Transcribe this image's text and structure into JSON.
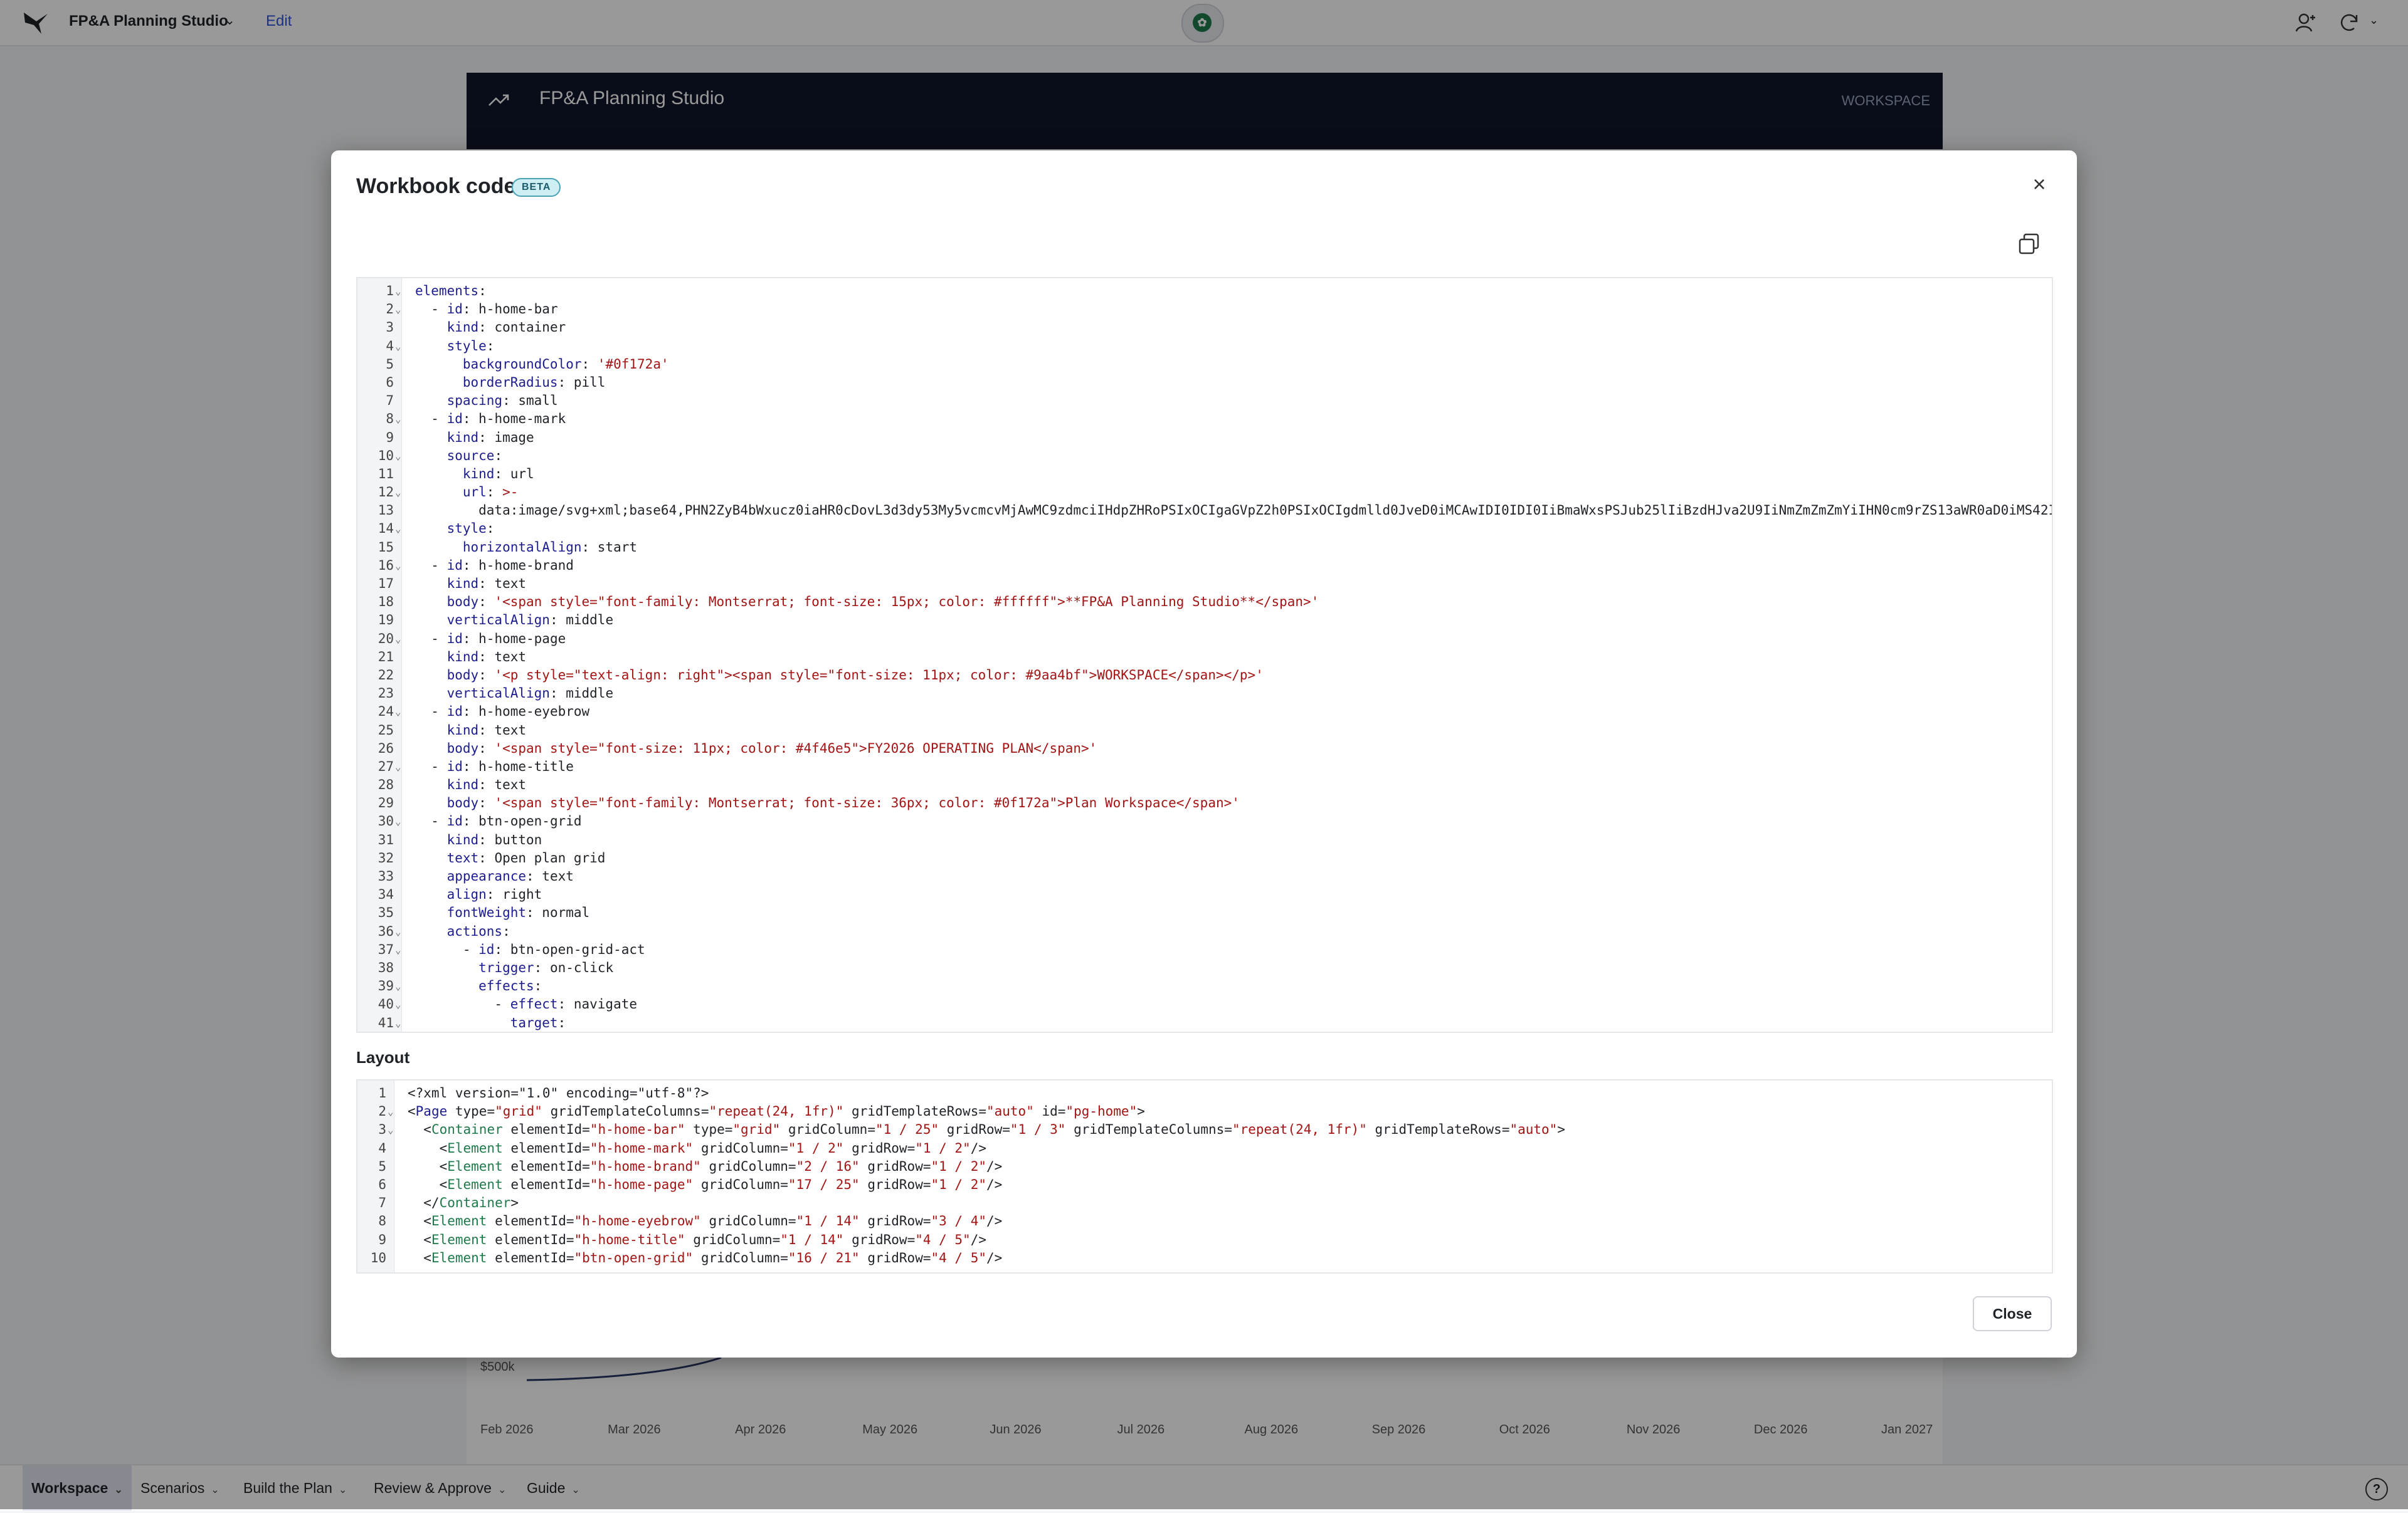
{
  "topbar": {
    "app_title": "FP&A Planning Studio",
    "edit_label": "Edit"
  },
  "background": {
    "header_brand": "FP&A Planning Studio",
    "header_right": "WORKSPACE",
    "chart": {
      "y_tick": "$500k",
      "x_ticks": [
        "Feb 2026",
        "Mar 2026",
        "Apr 2026",
        "May 2026",
        "Jun 2026",
        "Jul 2026",
        "Aug 2026",
        "Sep 2026",
        "Oct 2026",
        "Nov 2026",
        "Dec 2026",
        "Jan 2027"
      ]
    }
  },
  "bottom_tabs": [
    {
      "label": "Workspace",
      "active": true
    },
    {
      "label": "Scenarios",
      "active": false
    },
    {
      "label": "Build the Plan",
      "active": false
    },
    {
      "label": "Review & Approve",
      "active": false
    },
    {
      "label": "Guide",
      "active": false
    }
  ],
  "modal": {
    "title": "Workbook code",
    "badge": "BETA",
    "layout_heading": "Layout",
    "close_label": "Close",
    "code_lines": [
      {
        "n": "1",
        "fold": true,
        "segs": [
          [
            "k",
            "elements"
          ],
          [
            "p",
            ":"
          ]
        ]
      },
      {
        "n": "2",
        "fold": true,
        "segs": [
          [
            "p",
            "  - "
          ],
          [
            "k",
            "id"
          ],
          [
            "p",
            ": h-home-bar"
          ]
        ]
      },
      {
        "n": "3",
        "fold": false,
        "segs": [
          [
            "p",
            "    "
          ],
          [
            "k",
            "kind"
          ],
          [
            "p",
            ": container"
          ]
        ]
      },
      {
        "n": "4",
        "fold": true,
        "segs": [
          [
            "p",
            "    "
          ],
          [
            "k",
            "style"
          ],
          [
            "p",
            ":"
          ]
        ]
      },
      {
        "n": "5",
        "fold": false,
        "segs": [
          [
            "p",
            "      "
          ],
          [
            "k",
            "backgroundColor"
          ],
          [
            "p",
            ": "
          ],
          [
            "s",
            "'#0f172a'"
          ]
        ]
      },
      {
        "n": "6",
        "fold": false,
        "segs": [
          [
            "p",
            "      "
          ],
          [
            "k",
            "borderRadius"
          ],
          [
            "p",
            ": pill"
          ]
        ]
      },
      {
        "n": "7",
        "fold": false,
        "segs": [
          [
            "p",
            "    "
          ],
          [
            "k",
            "spacing"
          ],
          [
            "p",
            ": small"
          ]
        ]
      },
      {
        "n": "8",
        "fold": true,
        "segs": [
          [
            "p",
            "  - "
          ],
          [
            "k",
            "id"
          ],
          [
            "p",
            ": h-home-mark"
          ]
        ]
      },
      {
        "n": "9",
        "fold": false,
        "segs": [
          [
            "p",
            "    "
          ],
          [
            "k",
            "kind"
          ],
          [
            "p",
            ": image"
          ]
        ]
      },
      {
        "n": "10",
        "fold": true,
        "segs": [
          [
            "p",
            "    "
          ],
          [
            "k",
            "source"
          ],
          [
            "p",
            ":"
          ]
        ]
      },
      {
        "n": "11",
        "fold": false,
        "segs": [
          [
            "p",
            "      "
          ],
          [
            "k",
            "kind"
          ],
          [
            "p",
            ": url"
          ]
        ]
      },
      {
        "n": "12",
        "fold": true,
        "segs": [
          [
            "p",
            "      "
          ],
          [
            "k",
            "url"
          ],
          [
            "p",
            ": "
          ],
          [
            "s",
            ">-"
          ]
        ]
      },
      {
        "n": "13",
        "fold": false,
        "segs": [
          [
            "p",
            "        data:image/svg+xml;base64,PHN2ZyB4bWxucz0iaHR0cDovL3d3dy53My5vcmcvMjAwMC9zdmciIHdpZHRoPSIxOCIgaGVpZ2h0PSIxOCIgdmlld0JveD0iMCAwIDI0IDI0IiBmaWxsPSJub25lIiBzdHJva2U9IiNmZmZmZmYiIHN0cm9rZS13aWR0aD0iMS42Ii"
          ]
        ]
      },
      {
        "n": "14",
        "fold": true,
        "segs": [
          [
            "p",
            "    "
          ],
          [
            "k",
            "style"
          ],
          [
            "p",
            ":"
          ]
        ]
      },
      {
        "n": "15",
        "fold": false,
        "segs": [
          [
            "p",
            "      "
          ],
          [
            "k",
            "horizontalAlign"
          ],
          [
            "p",
            ": start"
          ]
        ]
      },
      {
        "n": "16",
        "fold": true,
        "segs": [
          [
            "p",
            "  - "
          ],
          [
            "k",
            "id"
          ],
          [
            "p",
            ": h-home-brand"
          ]
        ]
      },
      {
        "n": "17",
        "fold": false,
        "segs": [
          [
            "p",
            "    "
          ],
          [
            "k",
            "kind"
          ],
          [
            "p",
            ": text"
          ]
        ]
      },
      {
        "n": "18",
        "fold": false,
        "segs": [
          [
            "p",
            "    "
          ],
          [
            "k",
            "body"
          ],
          [
            "p",
            ": "
          ],
          [
            "s",
            "'<span style=\"font-family: Montserrat; font-size: 15px; color: #ffffff\">**FP&A Planning Studio**</span>'"
          ]
        ]
      },
      {
        "n": "19",
        "fold": false,
        "segs": [
          [
            "p",
            "    "
          ],
          [
            "k",
            "verticalAlign"
          ],
          [
            "p",
            ": middle"
          ]
        ]
      },
      {
        "n": "20",
        "fold": true,
        "segs": [
          [
            "p",
            "  - "
          ],
          [
            "k",
            "id"
          ],
          [
            "p",
            ": h-home-page"
          ]
        ]
      },
      {
        "n": "21",
        "fold": false,
        "segs": [
          [
            "p",
            "    "
          ],
          [
            "k",
            "kind"
          ],
          [
            "p",
            ": text"
          ]
        ]
      },
      {
        "n": "22",
        "fold": false,
        "segs": [
          [
            "p",
            "    "
          ],
          [
            "k",
            "body"
          ],
          [
            "p",
            ": "
          ],
          [
            "s",
            "'<p style=\"text-align: right\"><span style=\"font-size: 11px; color: #9aa4bf\">WORKSPACE</span></p>'"
          ]
        ]
      },
      {
        "n": "23",
        "fold": false,
        "segs": [
          [
            "p",
            "    "
          ],
          [
            "k",
            "verticalAlign"
          ],
          [
            "p",
            ": middle"
          ]
        ]
      },
      {
        "n": "24",
        "fold": true,
        "segs": [
          [
            "p",
            "  - "
          ],
          [
            "k",
            "id"
          ],
          [
            "p",
            ": h-home-eyebrow"
          ]
        ]
      },
      {
        "n": "25",
        "fold": false,
        "segs": [
          [
            "p",
            "    "
          ],
          [
            "k",
            "kind"
          ],
          [
            "p",
            ": text"
          ]
        ]
      },
      {
        "n": "26",
        "fold": false,
        "segs": [
          [
            "p",
            "    "
          ],
          [
            "k",
            "body"
          ],
          [
            "p",
            ": "
          ],
          [
            "s",
            "'<span style=\"font-size: 11px; color: #4f46e5\">FY2026 OPERATING PLAN</span>'"
          ]
        ]
      },
      {
        "n": "27",
        "fold": true,
        "segs": [
          [
            "p",
            "  - "
          ],
          [
            "k",
            "id"
          ],
          [
            "p",
            ": h-home-title"
          ]
        ]
      },
      {
        "n": "28",
        "fold": false,
        "segs": [
          [
            "p",
            "    "
          ],
          [
            "k",
            "kind"
          ],
          [
            "p",
            ": text"
          ]
        ]
      },
      {
        "n": "29",
        "fold": false,
        "segs": [
          [
            "p",
            "    "
          ],
          [
            "k",
            "body"
          ],
          [
            "p",
            ": "
          ],
          [
            "s",
            "'<span style=\"font-family: Montserrat; font-size: 36px; color: #0f172a\">Plan Workspace</span>'"
          ]
        ]
      },
      {
        "n": "30",
        "fold": true,
        "segs": [
          [
            "p",
            "  - "
          ],
          [
            "k",
            "id"
          ],
          [
            "p",
            ": btn-open-grid"
          ]
        ]
      },
      {
        "n": "31",
        "fold": false,
        "segs": [
          [
            "p",
            "    "
          ],
          [
            "k",
            "kind"
          ],
          [
            "p",
            ": button"
          ]
        ]
      },
      {
        "n": "32",
        "fold": false,
        "segs": [
          [
            "p",
            "    "
          ],
          [
            "k",
            "text"
          ],
          [
            "p",
            ": Open plan grid"
          ]
        ]
      },
      {
        "n": "33",
        "fold": false,
        "segs": [
          [
            "p",
            "    "
          ],
          [
            "k",
            "appearance"
          ],
          [
            "p",
            ": text"
          ]
        ]
      },
      {
        "n": "34",
        "fold": false,
        "segs": [
          [
            "p",
            "    "
          ],
          [
            "k",
            "align"
          ],
          [
            "p",
            ": right"
          ]
        ]
      },
      {
        "n": "35",
        "fold": false,
        "segs": [
          [
            "p",
            "    "
          ],
          [
            "k",
            "fontWeight"
          ],
          [
            "p",
            ": normal"
          ]
        ]
      },
      {
        "n": "36",
        "fold": true,
        "segs": [
          [
            "p",
            "    "
          ],
          [
            "k",
            "actions"
          ],
          [
            "p",
            ":"
          ]
        ]
      },
      {
        "n": "37",
        "fold": true,
        "segs": [
          [
            "p",
            "      - "
          ],
          [
            "k",
            "id"
          ],
          [
            "p",
            ": btn-open-grid-act"
          ]
        ]
      },
      {
        "n": "38",
        "fold": false,
        "segs": [
          [
            "p",
            "        "
          ],
          [
            "k",
            "trigger"
          ],
          [
            "p",
            ": on-click"
          ]
        ]
      },
      {
        "n": "39",
        "fold": true,
        "segs": [
          [
            "p",
            "        "
          ],
          [
            "k",
            "effects"
          ],
          [
            "p",
            ":"
          ]
        ]
      },
      {
        "n": "40",
        "fold": true,
        "segs": [
          [
            "p",
            "          - "
          ],
          [
            "k",
            "effect"
          ],
          [
            "p",
            ": navigate"
          ]
        ]
      },
      {
        "n": "41",
        "fold": true,
        "segs": [
          [
            "p",
            "            "
          ],
          [
            "k",
            "target"
          ],
          [
            "p",
            ":"
          ]
        ]
      }
    ],
    "layout_lines": [
      {
        "n": "1",
        "fold": false,
        "segs": [
          [
            "p",
            "<?xml version=\"1.0\" encoding=\"utf-8\"?>"
          ]
        ]
      },
      {
        "n": "2",
        "fold": true,
        "segs": [
          [
            "p",
            "<"
          ],
          [
            "a",
            "Page"
          ],
          [
            "p",
            " type="
          ],
          [
            "s",
            "\"grid\""
          ],
          [
            "p",
            " gridTemplateColumns="
          ],
          [
            "s",
            "\"repeat(24, 1fr)\""
          ],
          [
            "p",
            " gridTemplateRows="
          ],
          [
            "s",
            "\"auto\""
          ],
          [
            "p",
            " id="
          ],
          [
            "s",
            "\"pg-home\""
          ],
          [
            "p",
            ">"
          ]
        ]
      },
      {
        "n": "3",
        "fold": true,
        "segs": [
          [
            "p",
            "  <"
          ],
          [
            "t",
            "Container"
          ],
          [
            "p",
            " elementId="
          ],
          [
            "s",
            "\"h-home-bar\""
          ],
          [
            "p",
            " type="
          ],
          [
            "s",
            "\"grid\""
          ],
          [
            "p",
            " gridColumn="
          ],
          [
            "s",
            "\"1 / 25\""
          ],
          [
            "p",
            " gridRow="
          ],
          [
            "s",
            "\"1 / 3\""
          ],
          [
            "p",
            " gridTemplateColumns="
          ],
          [
            "s",
            "\"repeat(24, 1fr)\""
          ],
          [
            "p",
            " gridTemplateRows="
          ],
          [
            "s",
            "\"auto\""
          ],
          [
            "p",
            ">"
          ]
        ]
      },
      {
        "n": "4",
        "fold": false,
        "segs": [
          [
            "p",
            "    <"
          ],
          [
            "t",
            "Element"
          ],
          [
            "p",
            " elementId="
          ],
          [
            "s",
            "\"h-home-mark\""
          ],
          [
            "p",
            " gridColumn="
          ],
          [
            "s",
            "\"1 / 2\""
          ],
          [
            "p",
            " gridRow="
          ],
          [
            "s",
            "\"1 / 2\""
          ],
          [
            "p",
            "/>"
          ]
        ]
      },
      {
        "n": "5",
        "fold": false,
        "segs": [
          [
            "p",
            "    <"
          ],
          [
            "t",
            "Element"
          ],
          [
            "p",
            " elementId="
          ],
          [
            "s",
            "\"h-home-brand\""
          ],
          [
            "p",
            " gridColumn="
          ],
          [
            "s",
            "\"2 / 16\""
          ],
          [
            "p",
            " gridRow="
          ],
          [
            "s",
            "\"1 / 2\""
          ],
          [
            "p",
            "/>"
          ]
        ]
      },
      {
        "n": "6",
        "fold": false,
        "segs": [
          [
            "p",
            "    <"
          ],
          [
            "t",
            "Element"
          ],
          [
            "p",
            " elementId="
          ],
          [
            "s",
            "\"h-home-page\""
          ],
          [
            "p",
            " gridColumn="
          ],
          [
            "s",
            "\"17 / 25\""
          ],
          [
            "p",
            " gridRow="
          ],
          [
            "s",
            "\"1 / 2\""
          ],
          [
            "p",
            "/>"
          ]
        ]
      },
      {
        "n": "7",
        "fold": false,
        "segs": [
          [
            "p",
            "  </"
          ],
          [
            "t",
            "Container"
          ],
          [
            "p",
            ">"
          ]
        ]
      },
      {
        "n": "8",
        "fold": false,
        "segs": [
          [
            "p",
            "  <"
          ],
          [
            "t",
            "Element"
          ],
          [
            "p",
            " elementId="
          ],
          [
            "s",
            "\"h-home-eyebrow\""
          ],
          [
            "p",
            " gridColumn="
          ],
          [
            "s",
            "\"1 / 14\""
          ],
          [
            "p",
            " gridRow="
          ],
          [
            "s",
            "\"3 / 4\""
          ],
          [
            "p",
            "/>"
          ]
        ]
      },
      {
        "n": "9",
        "fold": false,
        "segs": [
          [
            "p",
            "  <"
          ],
          [
            "t",
            "Element"
          ],
          [
            "p",
            " elementId="
          ],
          [
            "s",
            "\"h-home-title\""
          ],
          [
            "p",
            " gridColumn="
          ],
          [
            "s",
            "\"1 / 14\""
          ],
          [
            "p",
            " gridRow="
          ],
          [
            "s",
            "\"4 / 5\""
          ],
          [
            "p",
            "/>"
          ]
        ]
      },
      {
        "n": "10",
        "fold": false,
        "segs": [
          [
            "p",
            "  <"
          ],
          [
            "t",
            "Element"
          ],
          [
            "p",
            " elementId="
          ],
          [
            "s",
            "\"btn-open-grid\""
          ],
          [
            "p",
            " gridColumn="
          ],
          [
            "s",
            "\"16 / 21\""
          ],
          [
            "p",
            " gridRow="
          ],
          [
            "s",
            "\"4 / 5\""
          ],
          [
            "p",
            "/>"
          ]
        ]
      }
    ]
  }
}
